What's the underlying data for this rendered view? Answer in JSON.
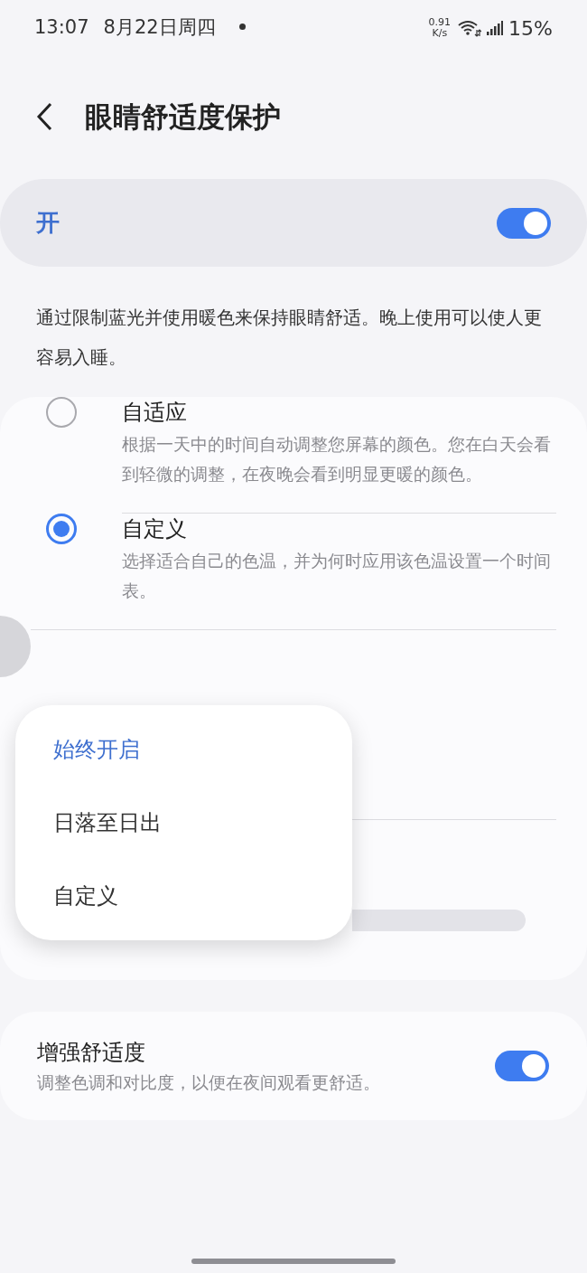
{
  "status_bar": {
    "time": "13:07",
    "date": "8月22日周四",
    "net_speed": "0.91",
    "net_unit": "K/s",
    "battery": "15%"
  },
  "header": {
    "title": "眼睛舒适度保护"
  },
  "master_switch": {
    "label": "开",
    "on": true
  },
  "description": "通过限制蓝光并使用暖色来保持眼睛舒适。晚上使用可以使人更容易入睡。",
  "modes": [
    {
      "title": "自适应",
      "description": "根据一天中的时间自动调整您屏幕的颜色。您在白天会看到轻微的调整，在夜晚会看到明显更暖的颜色。",
      "selected": false
    },
    {
      "title": "自定义",
      "description": "选择适合自己的色温，并为何时应用该色温设置一个时间表。",
      "selected": true
    }
  ],
  "schedule_menu": [
    {
      "label": "始终开启",
      "selected": true
    },
    {
      "label": "日落至日出",
      "selected": false
    },
    {
      "label": "自定义",
      "selected": false
    }
  ],
  "enhanced_comfort": {
    "title": "增强舒适度",
    "description": "调整色调和对比度，以便在夜间观看更舒适。",
    "on": true
  }
}
